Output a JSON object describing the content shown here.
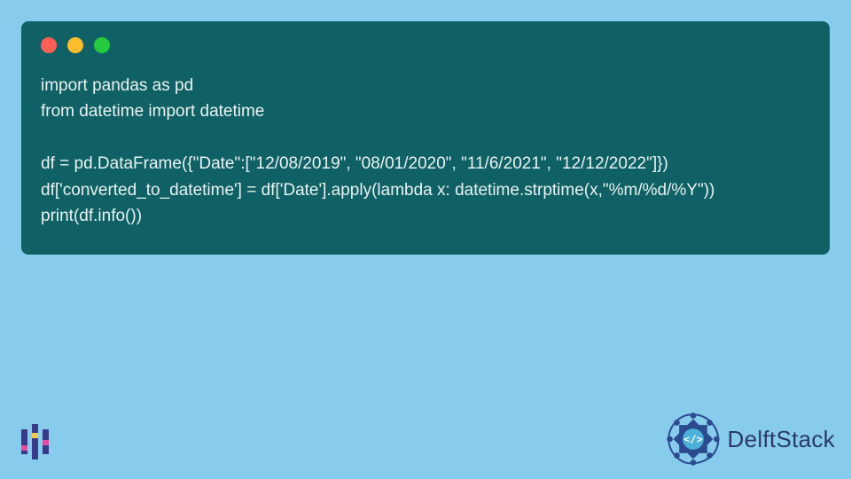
{
  "code": {
    "lines": [
      "import pandas as pd",
      "from datetime import datetime",
      "",
      "df = pd.DataFrame({\"Date\":[\"12/08/2019\", \"08/01/2020\", \"11/6/2021\", \"12/12/2022\"]})",
      "df['converted_to_datetime'] = df['Date'].apply(lambda x: datetime.strptime(x,\"%m/%d/%Y\"))",
      "print(df.info())"
    ]
  },
  "window": {
    "dot_red": "#ff5f56",
    "dot_yellow": "#ffbd2e",
    "dot_green": "#27c93f",
    "bg": "#0f6165"
  },
  "branding": {
    "right_text": "DelftStack"
  }
}
